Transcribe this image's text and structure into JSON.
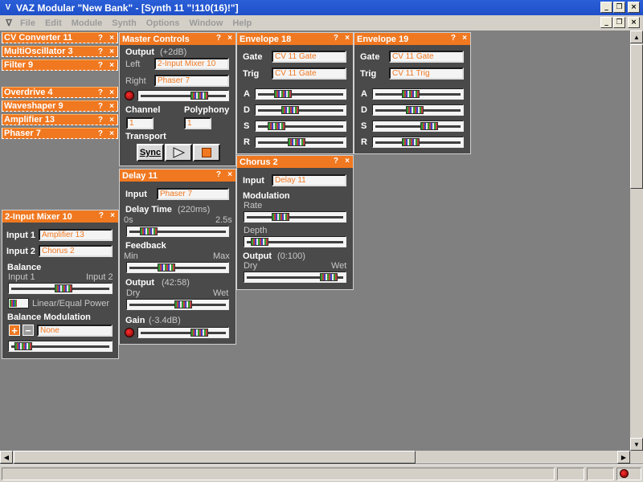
{
  "window": {
    "title": "VAZ Modular \"New Bank\" - [Synth 11 \"!110(16)!\"]",
    "controls": {
      "minimize": "_",
      "restore": "❐",
      "close": "×"
    }
  },
  "menu": {
    "items": [
      "File",
      "Edit",
      "Module",
      "Synth",
      "Options",
      "Window",
      "Help"
    ],
    "controls": {
      "minimize": "_",
      "restore": "❐",
      "close": "×"
    }
  },
  "collapsed_modules": [
    {
      "title": "CV Converter 11"
    },
    {
      "title": "MultiOscillator 3"
    },
    {
      "title": "Filter 9"
    },
    {
      "title": "Overdrive 4"
    },
    {
      "title": "Waveshaper 9"
    },
    {
      "title": "Amplifier 13"
    },
    {
      "title": "Phaser 7"
    }
  ],
  "panel_controls": {
    "help": "?",
    "close": "×"
  },
  "master": {
    "title": "Master Controls",
    "output_label": "Output",
    "output_value": "(+2dB)",
    "left_label": "Left",
    "left_value": "2-Input Mixer 10",
    "right_label": "Right",
    "right_value": "Phaser 7",
    "output_level": 0.72,
    "channel_label": "Channel",
    "channel_value": "1",
    "polyphony_label": "Polyphony",
    "polyphony_value": "1",
    "transport_label": "Transport",
    "sync_label": "Sync",
    "play_icon": "play-icon",
    "stop_icon": "stop-icon"
  },
  "env18": {
    "title": "Envelope 18",
    "gate_label": "Gate",
    "gate_value": "CV 11 Gate",
    "trig_label": "Trig",
    "trig_value": "CV 11 Gate",
    "a_label": "A",
    "a": 0.26,
    "d_label": "D",
    "d": 0.35,
    "s_label": "S",
    "s": 0.17,
    "r_label": "R",
    "r": 0.44
  },
  "env19": {
    "title": "Envelope 19",
    "gate_label": "Gate",
    "gate_value": "CV 11 Gate",
    "trig_label": "Trig",
    "trig_value": "CV 11 Trig",
    "a_label": "A",
    "a": 0.4,
    "d_label": "D",
    "d": 0.45,
    "s_label": "S",
    "s": 0.65,
    "r_label": "R",
    "r": 0.4
  },
  "delay": {
    "title": "Delay 11",
    "input_label": "Input",
    "input_value": "Phaser 7",
    "time_label": "Delay Time",
    "time_value": "(220ms)",
    "time_min": "0s",
    "time_max": "2.5s",
    "time_level": 0.15,
    "feedback_label": "Feedback",
    "feedback_min": "Min",
    "feedback_max": "Max",
    "feedback_level": 0.37,
    "output_label": "Output",
    "output_value": "(42:58)",
    "output_min": "Dry",
    "output_max": "Wet",
    "output_level": 0.57,
    "gain_label": "Gain",
    "gain_value": "(-3.4dB)",
    "gain_level": 0.72
  },
  "chorus": {
    "title": "Chorus 2",
    "input_label": "Input",
    "input_value": "Delay 11",
    "modulation_label": "Modulation",
    "rate_label": "Rate",
    "rate_level": 0.33,
    "depth_label": "Depth",
    "depth_level": 0.08,
    "output_label": "Output",
    "output_value": "(0:100)",
    "output_min": "Dry",
    "output_max": "Wet",
    "output_level": 0.9
  },
  "mixer": {
    "title": "2-Input Mixer 10",
    "input1_label": "Input 1",
    "input1_value": "Amplifier 13",
    "input2_label": "Input 2",
    "input2_value": "Chorus 2",
    "balance_label": "Balance",
    "balance_min": "Input 1",
    "balance_max": "Input 2",
    "balance_level": 0.54,
    "linear_label": "Linear/Equal Power",
    "balmod_label": "Balance Modulation",
    "plus_label": "+",
    "minus_label": "−",
    "balmod_value": "None",
    "balmod_level": 0.07
  }
}
